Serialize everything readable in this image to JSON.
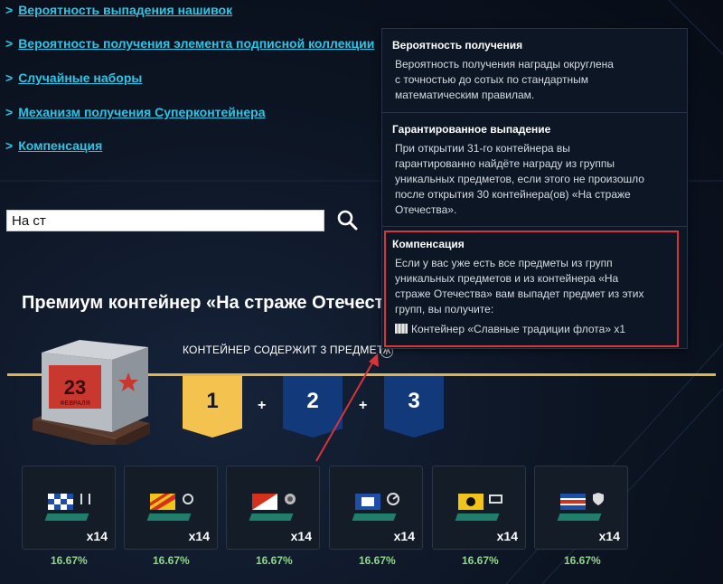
{
  "links": [
    {
      "chevron": ">",
      "label": "Вероятность выпадения нашивок"
    },
    {
      "chevron": ">",
      "label": "Вероятность получения элемента подписной коллекции"
    },
    {
      "chevron": ">",
      "label": "Случайные наборы"
    },
    {
      "chevron": ">",
      "label": "Механизм получения Суперконтейнера"
    },
    {
      "chevron": ">",
      "label": "Компенсация"
    }
  ],
  "search": {
    "value": "На ст",
    "icon": "search-icon"
  },
  "container": {
    "title": "Премиум контейнер «На страже Отечест",
    "contains_label": "КОНТЕЙНЕР СОДЕРЖИТ 3 ПРЕДМЕТА",
    "info_icon": "i",
    "groups": [
      {
        "number": "1",
        "color": "#f3c24f"
      },
      {
        "number": "2",
        "color": "#123a7a"
      },
      {
        "number": "3",
        "color": "#123a7a"
      }
    ],
    "plus": "+"
  },
  "items": [
    {
      "qty": "x14",
      "chance": "16.67%"
    },
    {
      "qty": "x14",
      "chance": "16.67%"
    },
    {
      "qty": "x14",
      "chance": "16.67%"
    },
    {
      "qty": "x14",
      "chance": "16.67%"
    },
    {
      "qty": "x14",
      "chance": "16.67%"
    },
    {
      "qty": "x14",
      "chance": "16.67%"
    }
  ],
  "tooltip": {
    "sections": [
      {
        "heading": "Вероятность получения",
        "body": "Вероятность получения награды округлена\nс точностью до сотых по стандартным\nматематическим правилам."
      },
      {
        "heading": "Гарантированное выпадение",
        "body": "При открытии 31-го контейнера вы\nгарантированно найдёте награду из группы\nуникальных предметов, если этого не произошло\nпосле открытия 30 контейнера(ов) «На страже\nОтечества»."
      },
      {
        "heading": "Компенсация",
        "body": "Если у вас уже есть все предметы из групп\nуникальных предметов и из контейнера «На\nстраже Отечества» вам выпадет предмет из этих\nгрупп, вы получите:",
        "reward": "Контейнер «Славные традиции флота» x1"
      }
    ]
  },
  "colors": {
    "link": "#2cc5e6",
    "gold": "#e2b54b",
    "highlight": "#d8343a",
    "percent": "#8fd88a"
  }
}
